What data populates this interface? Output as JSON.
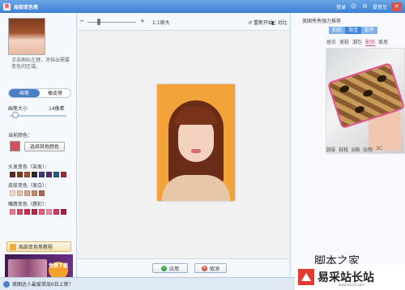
{
  "window": {
    "title": "局部变色笔",
    "actions": {
      "login": "登录",
      "help": "提意见"
    },
    "colors": {
      "titlebar": "#3f80d3",
      "accent": "#4a7fc4",
      "close": "#d9534f"
    }
  },
  "left": {
    "hint": "点击图标左键，涂抹出需要变色的区域。",
    "mode_tabs": [
      "画笔",
      "橡皮擦"
    ],
    "size_label": "画笔大小",
    "size_value": "14像素",
    "size_fraction": 0.05,
    "current_color_label": "当前颜色：",
    "current_color": "#d64f5a",
    "choose_color_button": "选择其他颜色",
    "groups": [
      {
        "label": "头发变色（染发）：",
        "colors": [
          "#5a2d1f",
          "#7b3a1e",
          "#a0522d",
          "#2b2b2b",
          "#3b3b7a",
          "#5b2a6e",
          "#2a5f7a",
          "#9b2f2f"
        ]
      },
      {
        "label": "皮肤变色（美白）：",
        "colors": [
          "#f1d8c8",
          "#e8c4ad",
          "#d9a989",
          "#c48a6b",
          "#a86e53"
        ]
      },
      {
        "label": "嘴唇变色（唇彩）：",
        "colors": [
          "#e87a8f",
          "#d44b6a",
          "#c92f54",
          "#b2284a",
          "#e05c7a",
          "#f08aa0",
          "#cc3b5e",
          "#a61f44"
        ]
      }
    ],
    "tutorial_button": "局部变色笔教程",
    "ad": {
      "badge": "免费下载"
    }
  },
  "toolbar": {
    "zoom_out": "−",
    "zoom_in": "+",
    "original": "1:1原大",
    "restart": "重新开始",
    "compare": "对比"
  },
  "footer": {
    "apply": "应用",
    "cancel": "取消"
  },
  "right": {
    "title": "美图秀秀强力推荐",
    "tabs": [
      "拍拍",
      "淘宝",
      "软件"
    ],
    "active_tab": 1,
    "categories": [
      "居衣",
      "美鞋",
      "潮包",
      "配饰",
      "家居"
    ],
    "active_category": 3,
    "categories2": [
      "潮服",
      "鞋靴",
      "B箱",
      "玩物",
      "3C"
    ]
  },
  "status": {
    "text": "美图达人最爱单品0日上新！"
  },
  "watermark": {
    "top": "脚本之家",
    "main": "易采站长站",
    "url": "www.easck.com"
  }
}
